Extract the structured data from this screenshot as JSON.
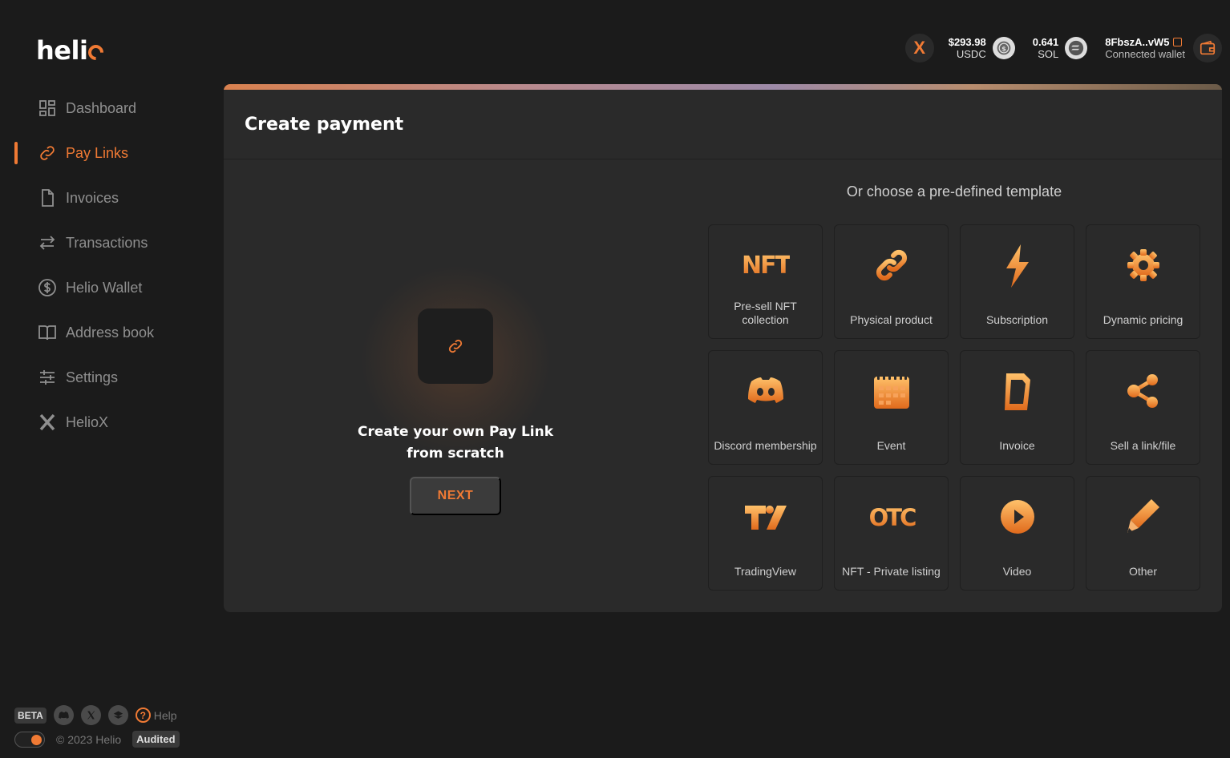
{
  "app": {
    "logo_text": "heli"
  },
  "sidebar": {
    "items": [
      {
        "label": "Dashboard",
        "icon": "dashboard-icon",
        "active": false
      },
      {
        "label": "Pay Links",
        "icon": "link-icon",
        "active": true
      },
      {
        "label": "Invoices",
        "icon": "document-icon",
        "active": false
      },
      {
        "label": "Transactions",
        "icon": "transfer-icon",
        "active": false
      },
      {
        "label": "Helio Wallet",
        "icon": "dollar-icon",
        "active": false
      },
      {
        "label": "Address book",
        "icon": "book-icon",
        "active": false
      },
      {
        "label": "Settings",
        "icon": "sliders-icon",
        "active": false
      },
      {
        "label": "HelioX",
        "icon": "heliox-icon",
        "active": false
      }
    ],
    "footer": {
      "beta": "BETA",
      "help": "Help",
      "copyright": "© 2023 Helio",
      "audited": "Audited"
    }
  },
  "topbar": {
    "usdc_amount": "$293.98",
    "usdc_unit": "USDC",
    "sol_amount": "0.641",
    "sol_unit": "SOL",
    "wallet_address": "8FbszA..vW5",
    "wallet_label": "Connected wallet"
  },
  "card": {
    "title": "Create payment",
    "scratch_line1": "Create your own Pay Link",
    "scratch_line2": "from scratch",
    "next_label": "NEXT",
    "templates_title": "Or choose a pre-defined template",
    "templates": [
      {
        "label": "Pre-sell NFT collection",
        "icon": "nft-icon"
      },
      {
        "label": "Physical product",
        "icon": "chain-link-icon"
      },
      {
        "label": "Subscription",
        "icon": "lightning-icon"
      },
      {
        "label": "Dynamic pricing",
        "icon": "gear-icon"
      },
      {
        "label": "Discord membership",
        "icon": "discord-icon"
      },
      {
        "label": "Event",
        "icon": "calendar-icon"
      },
      {
        "label": "Invoice",
        "icon": "invoice-icon"
      },
      {
        "label": "Sell a link/file",
        "icon": "share-icon"
      },
      {
        "label": "TradingView",
        "icon": "tradingview-icon"
      },
      {
        "label": "NFT - Private listing",
        "icon": "otc-icon"
      },
      {
        "label": "Video",
        "icon": "play-icon"
      },
      {
        "label": "Other",
        "icon": "pencil-icon"
      }
    ]
  },
  "colors": {
    "accent": "#f07a34",
    "background": "#1b1b1b",
    "card": "#2a2a2a"
  }
}
